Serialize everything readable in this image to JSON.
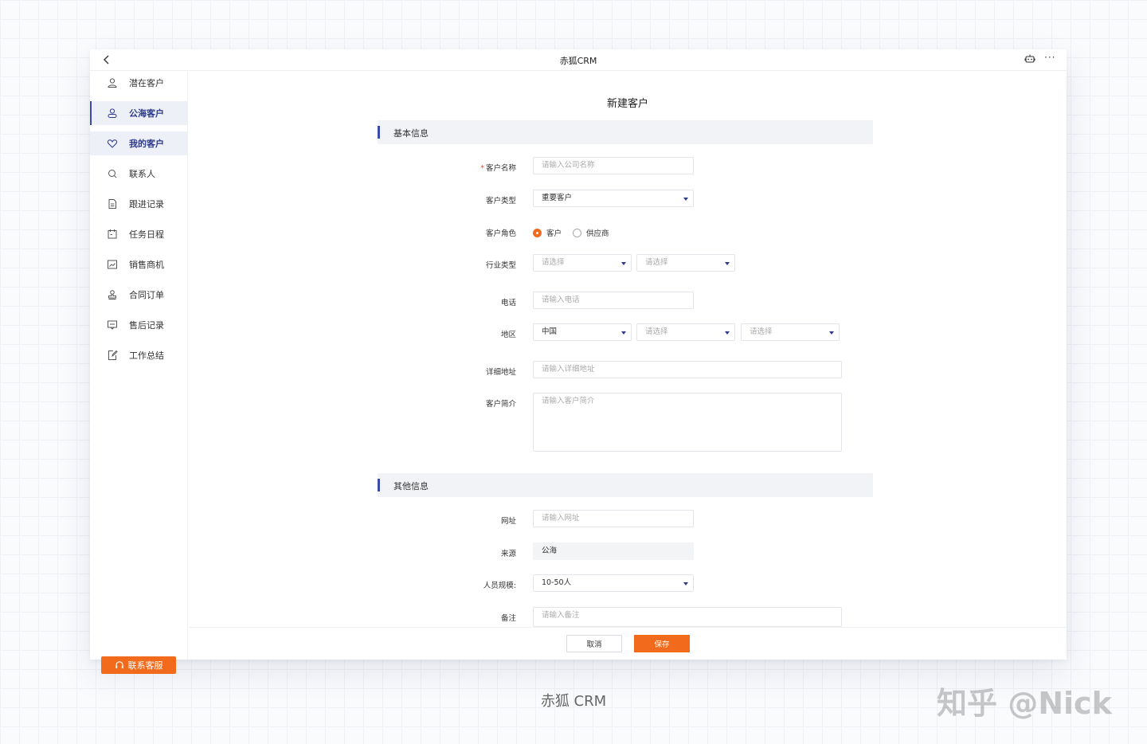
{
  "window": {
    "title": "赤狐CRM"
  },
  "sidebar": {
    "items": [
      {
        "label": "潜在客户",
        "icon": "user-icon"
      },
      {
        "label": "公海客户",
        "icon": "group-user-icon"
      },
      {
        "label": "我的客户",
        "icon": "heart-icon"
      },
      {
        "label": "联系人",
        "icon": "search-contact-icon"
      },
      {
        "label": "跟进记录",
        "icon": "document-icon"
      },
      {
        "label": "任务日程",
        "icon": "calendar-icon"
      },
      {
        "label": "销售商机",
        "icon": "chart-icon"
      },
      {
        "label": "合同订单",
        "icon": "stamp-icon"
      },
      {
        "label": "售后记录",
        "icon": "message-icon"
      },
      {
        "label": "工作总结",
        "icon": "edit-note-icon"
      }
    ],
    "service_button": "联系客服"
  },
  "form": {
    "title": "新建客户",
    "basic_section": "基本信息",
    "other_section": "其他信息",
    "customer_name": {
      "label": "客户名称",
      "placeholder": "请输入公司名称"
    },
    "customer_type": {
      "label": "客户类型",
      "value": "重要客户"
    },
    "customer_role": {
      "label": "客户角色",
      "options": [
        "客户",
        "供应商"
      ],
      "selected": "客户"
    },
    "industry": {
      "label": "行业类型",
      "placeholder1": "请选择",
      "placeholder2": "请选择"
    },
    "phone": {
      "label": "电话",
      "placeholder": "请输入电话"
    },
    "region": {
      "label": "地区",
      "value": "中国",
      "placeholder2": "请选择",
      "placeholder3": "请选择"
    },
    "address": {
      "label": "详细地址",
      "placeholder": "请输入详细地址"
    },
    "intro": {
      "label": "客户简介",
      "placeholder": "请输入客户简介"
    },
    "website": {
      "label": "网址",
      "placeholder": "请输入网址"
    },
    "source": {
      "label": "来源",
      "value": "公海"
    },
    "staff_size": {
      "label": "人员规模:",
      "value": "10-50人"
    },
    "remark": {
      "label": "备注",
      "placeholder": "请输入备注"
    }
  },
  "footer": {
    "cancel": "取消",
    "save": "保存"
  },
  "caption": "赤狐 CRM",
  "watermark": "知乎 @Nick",
  "colors": {
    "accent": "#f26b1d",
    "primary": "#3a4aa8"
  }
}
